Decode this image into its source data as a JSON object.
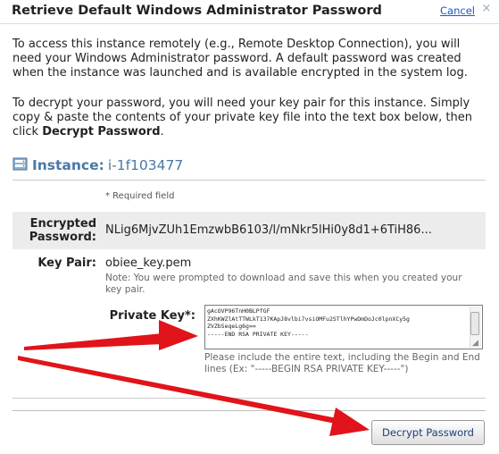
{
  "dialog": {
    "title": "Retrieve Default Windows Administrator Password",
    "cancel_label": "Cancel",
    "close_glyph": "×"
  },
  "intro": {
    "paragraph1": "To access this instance remotely (e.g., Remote Desktop Connection), you will need your Windows Administrator password. A default password was created when the instance was launched and is available encrypted in the system log.",
    "paragraph2_prefix": "To decrypt your password, you will need your key pair for this instance. Simply copy & paste the contents of your private key file into the text box below, then click ",
    "paragraph2_bold": "Decrypt Password",
    "paragraph2_suffix": "."
  },
  "instance": {
    "label": "Instance:",
    "id": "i-1f103477",
    "icon": "instance-icon"
  },
  "required_note": "* Required field",
  "encrypted_password": {
    "label": "Encrypted Password:",
    "value": "NLig6MjvZUh1EmzwbB6103/l/mNkr5lHi0y8d1+6TiH86..."
  },
  "key_pair": {
    "label": "Key Pair:",
    "value": "obiee_key.pem",
    "note": "Note: You were prompted to download and save this when you created your key pair."
  },
  "private_key": {
    "label": "Private Key*:",
    "value": "gAcOVP96TnH0BLPfGF\nZXhKWZlAtTTWLkT137KApJ8vlbi7vsiOMFu2STlhYPwDmDoJc0lpnXCy5g\nZVZbSeqeLg6g==\n-----END RSA PRIVATE KEY-----",
    "note": "Please include the entire text, including the Begin and End lines (Ex: \"-----BEGIN RSA PRIVATE KEY-----\")"
  },
  "actions": {
    "decrypt_label": "Decrypt Password"
  },
  "colors": {
    "accent_blue": "#4a78a6",
    "link_blue": "#1a57c9",
    "arrow_red": "#e0141a",
    "field_bg": "#ececec"
  }
}
